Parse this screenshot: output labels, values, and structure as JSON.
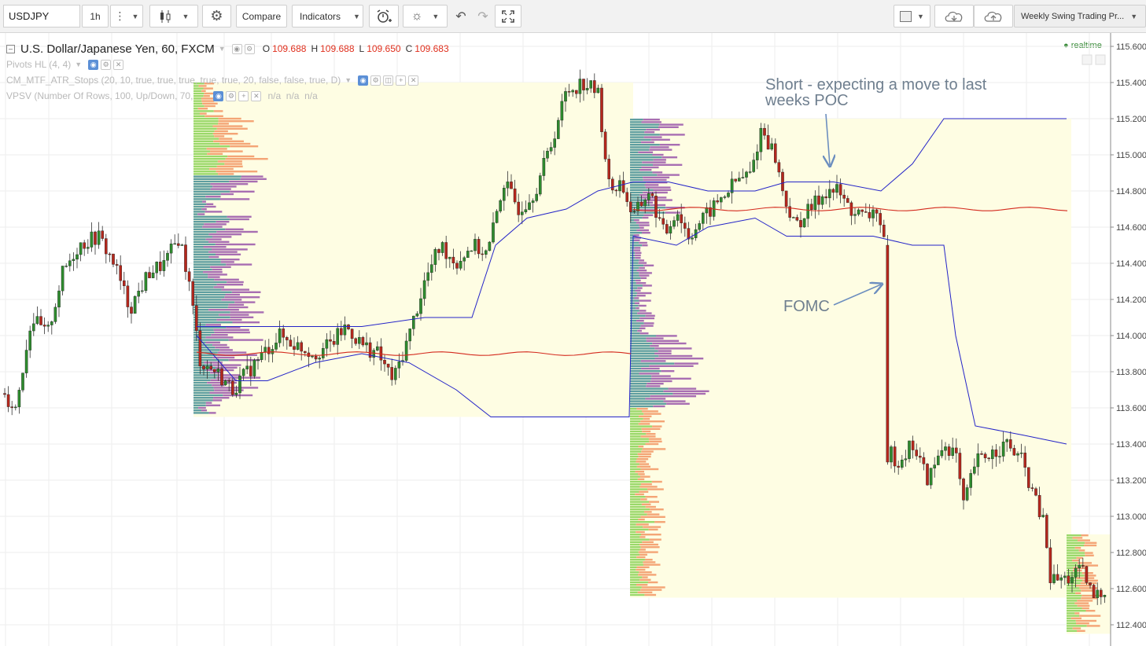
{
  "toolbar": {
    "symbol": "USDJPY",
    "interval": "1h",
    "compare_label": "Compare",
    "indicators_label": "Indicators",
    "layout_name": "Weekly Swing Trading Pr..."
  },
  "legend": {
    "title": "U.S. Dollar/Japanese Yen, 60, FXCM",
    "o_label": "O",
    "o_value": "109.688",
    "h_label": "H",
    "h_value": "109.688",
    "l_label": "L",
    "l_value": "109.650",
    "c_label": "C",
    "c_value": "109.683",
    "indicators": [
      "Pivots HL (4, 4)",
      "CM_MTF_ATR_Stops (20, 10, true, true, true, true, true, 20, false, false, true, D)",
      "VPSV (Number Of Rows, 100, Up/Down, 70,"
    ],
    "vpsv_values": "n/a  n/a  n/a",
    "realtime": "realtime"
  },
  "annotations": {
    "short_text_line1": "Short - expecting a move to last",
    "short_text_line2": "weeks POC",
    "fomc_text": "FOMC"
  },
  "chart_data": {
    "type": "candlestick",
    "symbol": "USDJPY",
    "timeframe": "60",
    "ylim": [
      112.3,
      115.65
    ],
    "y_ticks": [
      "115.600",
      "115.400",
      "115.200",
      "115.000",
      "114.800",
      "114.600",
      "114.400",
      "114.200",
      "114.000",
      "113.800",
      "113.600",
      "113.400",
      "113.200",
      "113.000",
      "112.800",
      "112.600",
      "112.400"
    ],
    "price_path": [
      [
        0,
        113.7
      ],
      [
        20,
        113.6
      ],
      [
        40,
        114.1
      ],
      [
        60,
        114.0
      ],
      [
        80,
        114.35
      ],
      [
        100,
        114.5
      ],
      [
        125,
        114.55
      ],
      [
        145,
        114.4
      ],
      [
        165,
        114.15
      ],
      [
        190,
        114.35
      ],
      [
        210,
        114.4
      ],
      [
        228,
        114.55
      ],
      [
        240,
        114.3
      ],
      [
        255,
        113.85
      ],
      [
        275,
        113.8
      ],
      [
        295,
        113.7
      ],
      [
        315,
        113.8
      ],
      [
        335,
        113.9
      ],
      [
        355,
        114.0
      ],
      [
        375,
        113.95
      ],
      [
        400,
        113.9
      ],
      [
        420,
        113.95
      ],
      [
        440,
        114.05
      ],
      [
        460,
        113.95
      ],
      [
        480,
        113.9
      ],
      [
        500,
        113.75
      ],
      [
        520,
        114.0
      ],
      [
        540,
        114.3
      ],
      [
        560,
        114.5
      ],
      [
        580,
        114.4
      ],
      [
        600,
        114.5
      ],
      [
        620,
        114.45
      ],
      [
        640,
        114.85
      ],
      [
        660,
        114.7
      ],
      [
        680,
        114.8
      ],
      [
        700,
        115.05
      ],
      [
        720,
        115.35
      ],
      [
        740,
        115.4
      ],
      [
        760,
        115.35
      ],
      [
        775,
        114.8
      ],
      [
        790,
        114.85
      ],
      [
        805,
        114.65
      ],
      [
        825,
        114.8
      ],
      [
        845,
        114.55
      ],
      [
        860,
        114.7
      ],
      [
        875,
        114.55
      ],
      [
        895,
        114.65
      ],
      [
        915,
        114.75
      ],
      [
        935,
        114.85
      ],
      [
        955,
        114.9
      ],
      [
        968,
        115.15
      ],
      [
        985,
        115.0
      ],
      [
        995,
        114.8
      ],
      [
        1010,
        114.6
      ],
      [
        1030,
        114.7
      ],
      [
        1050,
        114.8
      ],
      [
        1065,
        114.8
      ],
      [
        1080,
        114.7
      ],
      [
        1100,
        114.65
      ],
      [
        1115,
        114.7
      ],
      [
        1124,
        114.5
      ],
      [
        1128,
        113.4
      ],
      [
        1140,
        113.3
      ],
      [
        1160,
        113.4
      ],
      [
        1180,
        113.2
      ],
      [
        1200,
        113.4
      ],
      [
        1215,
        113.35
      ],
      [
        1225,
        113.05
      ],
      [
        1240,
        113.3
      ],
      [
        1260,
        113.35
      ],
      [
        1280,
        113.4
      ],
      [
        1300,
        113.3
      ],
      [
        1315,
        113.1
      ],
      [
        1328,
        112.95
      ],
      [
        1335,
        112.65
      ],
      [
        1355,
        112.65
      ],
      [
        1375,
        112.7
      ],
      [
        1390,
        112.55
      ],
      [
        1408,
        112.6
      ]
    ],
    "atr_upper": [
      [
        250,
        114.05
      ],
      [
        420,
        114.05
      ],
      [
        460,
        114.05
      ],
      [
        540,
        114.1
      ],
      [
        600,
        114.1
      ],
      [
        630,
        114.5
      ],
      [
        670,
        114.65
      ],
      [
        720,
        114.7
      ],
      [
        760,
        114.8
      ],
      [
        805,
        114.85
      ],
      [
        850,
        114.85
      ],
      [
        900,
        114.8
      ],
      [
        960,
        114.8
      ],
      [
        1000,
        114.85
      ],
      [
        1060,
        114.85
      ],
      [
        1120,
        114.8
      ],
      [
        1160,
        114.95
      ],
      [
        1200,
        115.2
      ],
      [
        1356,
        115.2
      ]
    ],
    "atr_lower": [
      [
        250,
        114.0
      ],
      [
        300,
        113.75
      ],
      [
        340,
        113.75
      ],
      [
        400,
        113.85
      ],
      [
        460,
        113.9
      ],
      [
        520,
        113.85
      ],
      [
        580,
        113.7
      ],
      [
        624,
        113.55
      ],
      [
        800,
        113.55
      ],
      [
        805,
        114.55
      ],
      [
        860,
        114.5
      ],
      [
        900,
        114.6
      ],
      [
        960,
        114.65
      ],
      [
        1000,
        114.55
      ],
      [
        1060,
        114.55
      ],
      [
        1110,
        114.55
      ],
      [
        1160,
        114.5
      ],
      [
        1200,
        114.5
      ],
      [
        1215,
        114.0
      ],
      [
        1240,
        113.5
      ],
      [
        1300,
        113.45
      ],
      [
        1356,
        113.4
      ]
    ],
    "poc_lines": [
      {
        "start": 250,
        "end": 810,
        "price": 113.9
      },
      {
        "start": 805,
        "end": 1360,
        "price": 114.7
      }
    ],
    "volume_profiles": [
      {
        "x_start": 246,
        "x_end": 805,
        "y_top": 115.4,
        "y_bottom": 113.55
      },
      {
        "x_start": 801,
        "x_end": 1362,
        "y_top": 115.2,
        "y_bottom": 112.55
      },
      {
        "x_start": 1356,
        "x_end": 1412,
        "y_top": 112.9,
        "y_bottom": 112.35
      }
    ]
  }
}
